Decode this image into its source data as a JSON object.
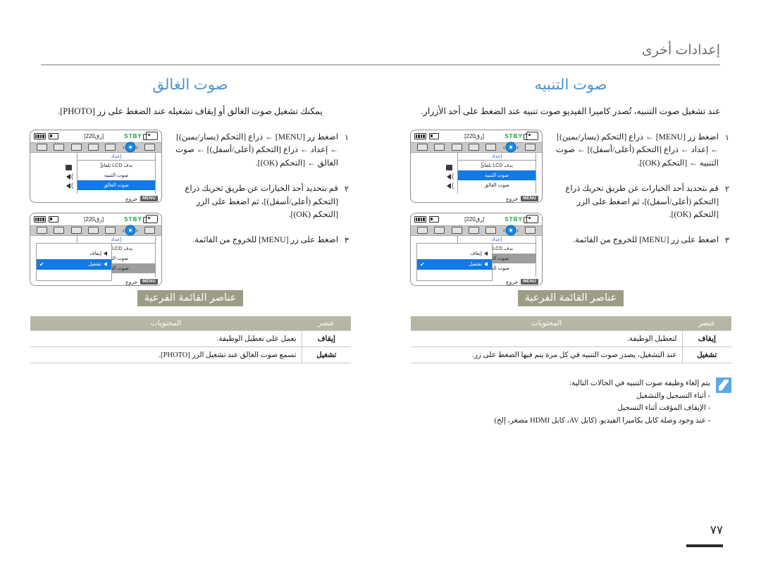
{
  "running_head": "إعدادات أخرى",
  "page_number": "٧٧",
  "colors": {
    "section_title": "#4a93d1",
    "badge_bg": "#9d9c86",
    "table_header_bg": "#b7b6a4",
    "lcd_highlight": "#1279e8",
    "lcd_stby": "#12a035",
    "note_icon_bg": "#5aa9e8"
  },
  "left_column": {
    "title": "صوت الغالق",
    "lead": "يمكنك تشغيل صوت الغالق أو إيقاف تشغيله عند الضغط على زر [PHOTO].",
    "steps": [
      {
        "num": "١",
        "text": "اضغط زر [MENU] ← ذراع [التحكم (يسار/يمين)] ← إعداد ← ذراع [التحكم (أعلى/أسفل)] ← صوت الغالق ← [التحكم (OK)]."
      },
      {
        "num": "٢",
        "text": "قم بتحديد أحد الخيارات عن طريق تحريك ذراع [التحكم (أعلى/أسفل)]، ثم اضغط على الزر [التحكم (OK)]."
      },
      {
        "num": "٣",
        "text": "اضغط على زر [MENU] للخروج من القائمة."
      }
    ],
    "screens": [
      {
        "stby": "STBY",
        "frames": "[220رق]",
        "menu_head": "إعداد",
        "rows": [
          {
            "label": "بدف LCD تلقائً",
            "state": "normal",
            "icon": "square-icon"
          },
          {
            "label": "صوت التنبيه",
            "state": "normal",
            "icon": "speaker-icon"
          },
          {
            "label": "صوت الغالق",
            "state": "selected",
            "icon": "speaker-icon"
          }
        ],
        "exit_button": "MENU",
        "exit_label": "خروج",
        "submenu": null
      },
      {
        "stby": "STBY",
        "frames": "[220رق]",
        "menu_head": "إعداد",
        "rows": [
          {
            "label": "بدف LCD تلقائً",
            "state": "normal",
            "icon": "square-icon"
          },
          {
            "label": "صوت التنبيه",
            "state": "normal",
            "icon": "speaker-icon"
          },
          {
            "label": "صوت الغالق",
            "state": "grey",
            "icon": "speaker-icon"
          }
        ],
        "exit_button": "MENU",
        "exit_label": "خروج",
        "submenu": {
          "options": [
            {
              "label": "إيقاف",
              "selected": false
            },
            {
              "label": "تشغيل",
              "selected": true
            }
          ]
        }
      }
    ],
    "submenu_section": {
      "badge": "عناصر القائمة الفرعية",
      "table": {
        "headers": [
          "عنصر",
          "المحتويات"
        ],
        "rows": [
          {
            "item": "إيقاف",
            "desc": "يعمل على تعطيل الوظيفة."
          },
          {
            "item": "تشغيل",
            "desc": "تسمع صوت الغالق عند تشغيل الزر [PHOTO]."
          }
        ]
      }
    }
  },
  "right_column": {
    "title": "صوت التنبيه",
    "lead": "عند تشغيل صوت التنبيه، تُصدر كاميرا الفيديو صوت تنبيه عند الضغط على أحد الأزرار.",
    "steps": [
      {
        "num": "١",
        "text": "اضغط زر [MENU] ← ذراع [التحكم (يسار/يمين)] ← إعداد ← ذراع [التحكم (أعلى/أسفل)] ← صوت التنبيه ← [التحكم (OK)]."
      },
      {
        "num": "٢",
        "text": "قم بتحديد أحد الخيارات عن طريق تحريك ذراع [التحكم (أعلى/أسفل)]، ثم اضغط على الزر [التحكم (OK)]."
      },
      {
        "num": "٣",
        "text": "اضغط على زر [MENU] للخروج من القائمة."
      }
    ],
    "screens": [
      {
        "stby": "STBY",
        "frames": "[220رق]",
        "menu_head": "إعداد",
        "rows": [
          {
            "label": "بدف LCD تلقائً",
            "state": "normal",
            "icon": "square-icon"
          },
          {
            "label": "صوت التنبيه",
            "state": "selected",
            "icon": "speaker-icon"
          },
          {
            "label": "صوت الغالق",
            "state": "normal",
            "icon": "speaker-icon"
          }
        ],
        "exit_button": "MENU",
        "exit_label": "خروج",
        "submenu": null
      },
      {
        "stby": "STBY",
        "frames": "[220رق]",
        "menu_head": "إعداد",
        "rows": [
          {
            "label": "بدف LCD تلقائً",
            "state": "normal",
            "icon": "square-icon"
          },
          {
            "label": "صوت التنبيه",
            "state": "grey",
            "icon": "speaker-icon"
          },
          {
            "label": "صوت الغالق",
            "state": "normal",
            "icon": "speaker-icon"
          }
        ],
        "exit_button": "MENU",
        "exit_label": "خروج",
        "submenu": {
          "options": [
            {
              "label": "إيقاف",
              "selected": false
            },
            {
              "label": "تشغيل",
              "selected": true
            }
          ]
        }
      }
    ],
    "submenu_section": {
      "badge": "عناصر القائمة الفرعية",
      "table": {
        "headers": [
          "عنصر",
          "المحتويات"
        ],
        "rows": [
          {
            "item": "إيقاف",
            "desc": "لتعطيل الوظيفة."
          },
          {
            "item": "تشغيل",
            "desc": "عند التشغيل، يصدر صوت التنبيه في كل مرة يتم فيها الضغط على زر."
          }
        ]
      }
    },
    "note": {
      "heading": "يتم إلغاء وظيفة صوت التنبيه في الحالات التالية:",
      "items": [
        "أثناء التسجيل والتشغيل",
        "الإيقاف المؤقت أثناء التسجيل",
        "عند وجود وصلة كابل بكاميرا الفيديو. (كابل AV، كابل HDMI مصغر، إلخ)"
      ]
    }
  }
}
